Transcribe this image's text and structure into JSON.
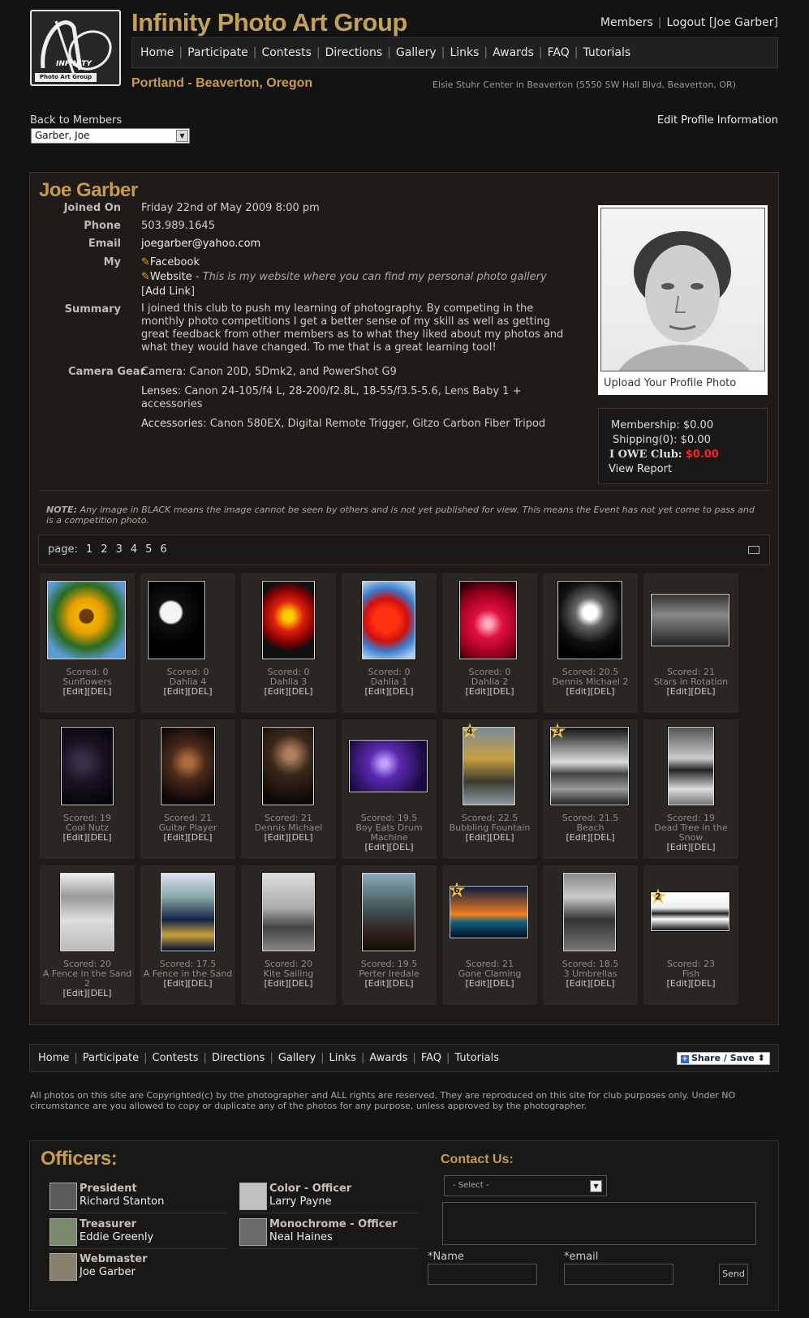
{
  "header": {
    "site_title": "Infinity Photo Art Group",
    "logo_text_1": "INFINITY",
    "logo_text_2": "Photo Art Group",
    "location": "Portland - Beaverton, Oregon",
    "address": "Elsie Stuhr Center in Beaverton (5550 SW Hall Blvd, Beaverton, OR)",
    "account": {
      "members": "Members",
      "logout": "Logout",
      "user": "[Joe Garber]"
    }
  },
  "nav": [
    "Home",
    "Participate",
    "Contests",
    "Directions",
    "Gallery",
    "Links",
    "Awards",
    "FAQ",
    "Tutorials"
  ],
  "back_label": "Back to Members",
  "member_select": "Garber, Joe",
  "edit_profile": "Edit Profile Information",
  "profile": {
    "name": "Joe Garber",
    "joined_label": "Joined On",
    "joined": "Friday 22nd of May 2009 8:00 pm",
    "phone_label": "Phone",
    "phone": "503.989.1645",
    "email_label": "Email",
    "email": "joegarber@yahoo.com",
    "my_label": "My",
    "facebook": "Facebook",
    "website": "Website",
    "website_desc": "This is my website where you can find my personal photo gallery",
    "add_link": "Add Link",
    "summary_label": "Summary",
    "summary": "I joined this club to push my learning of photography. By competing in the monthly photo competitions I get a better sense of my skill as well as getting great feedback from other members as to what they liked about my photos and what they would have changed. To me that is a great learning tool!",
    "gear_label": "Camera Gear",
    "camera_label": "Camera",
    "camera": "Canon 20D, 5Dmk2, and PowerShot G9",
    "lenses_label": "Lenses",
    "lenses": "Canon 24-105/f4 L, 28-200/f2.8L, 18-55/f3.5-5.6, Lens Baby 1 + accessories",
    "accessories_label": "Accessories",
    "accessories": "Canon 580EX, Digital Remote Trigger, Gitzo Carbon Fiber Tripod",
    "upload_photo": "Upload Your Profile Photo"
  },
  "account_box": {
    "membership_label": "Membership:",
    "membership": "$0.00",
    "shipping_label": "Shipping(0):",
    "shipping": "$0.00",
    "owe_label": "I OWE Club:",
    "owe": "$0.00",
    "owe_color": "#ff2020",
    "view_report": "View Report"
  },
  "note_label": "NOTE:",
  "note": "Any image in BLACK means the image cannot be seen by others and is not yet published for view. This means the Event has not yet come to pass and is a competition photo.",
  "pager": {
    "label": "page:",
    "pages": [
      "1",
      "2",
      "3",
      "4",
      "5",
      "6"
    ]
  },
  "edit_del": "[Edit][DEL]",
  "thumbs": [
    {
      "score": "Scored: 0",
      "title": "Sunflowers",
      "star": ""
    },
    {
      "score": "Scored: 0",
      "title": "Dahlia 4",
      "star": ""
    },
    {
      "score": "Scored: 0",
      "title": "Dahlia 3",
      "star": ""
    },
    {
      "score": "Scored: 0",
      "title": "Dahlia 1",
      "star": ""
    },
    {
      "score": "Scored: 0",
      "title": "Dahlia 2",
      "star": ""
    },
    {
      "score": "Scored: 20.5",
      "title": "Dennis Michael 2",
      "star": ""
    },
    {
      "score": "Scored: 21",
      "title": "Stars in Rotation",
      "star": ""
    },
    {
      "score": "Scored: 19",
      "title": "Cool Nutz",
      "star": ""
    },
    {
      "score": "Scored: 21",
      "title": "Guitar Player",
      "star": ""
    },
    {
      "score": "Scored: 21",
      "title": "Dennis Michael",
      "star": ""
    },
    {
      "score": "Scored: 19.5",
      "title": "Boy Eats Drum Machine",
      "star": ""
    },
    {
      "score": "Scored: 22.5",
      "title": "Bubbling Fountain",
      "star": "4"
    },
    {
      "score": "Scored: 21.5",
      "title": "Beach",
      "star": "3"
    },
    {
      "score": "Scored: 19",
      "title": "Dead Tree in the Snow",
      "star": ""
    },
    {
      "score": "Scored: 20",
      "title": "A Fence in the Sand 2",
      "star": ""
    },
    {
      "score": "Scored: 17.5",
      "title": "A Fence in the Sand",
      "star": ""
    },
    {
      "score": "Scored: 20",
      "title": "Kite Sailing",
      "star": ""
    },
    {
      "score": "Scored: 19.5",
      "title": "Perter Iredale",
      "star": ""
    },
    {
      "score": "Scored: 21",
      "title": "Gone Claming",
      "star": "6"
    },
    {
      "score": "Scored: 18.5",
      "title": "3 Umbrellas",
      "star": ""
    },
    {
      "score": "Scored: 23",
      "title": "Fish",
      "star": "2"
    }
  ],
  "share": "Share / Save",
  "copyright": "All photos on this site are Copyrighted(c) by the photographer and ALL rights are reserved. They are reproduced on this site for club purposes only. Under NO circumstance are you allowed to copy or duplicate any of the photos for any purpose, unless approved by the photographer.",
  "officers_title": "Officers:",
  "officers": [
    {
      "role": "President",
      "name": "Richard Stanton"
    },
    {
      "role": "Treasurer",
      "name": "Eddie Greenly"
    },
    {
      "role": "Webmaster",
      "name": "Joe Garber"
    },
    {
      "role": "Color - Officer",
      "name": "Larry Payne"
    },
    {
      "role": "Monochrome - Officer",
      "name": "Neal Haines"
    }
  ],
  "contact": {
    "title": "Contact Us:",
    "select": "- Select -",
    "name_label": "*Name",
    "email_label": "*email",
    "send": "Send"
  }
}
